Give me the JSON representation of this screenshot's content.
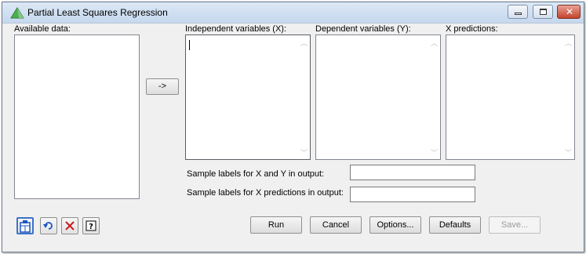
{
  "window": {
    "title": "Partial Least Squares Regression",
    "controls": {
      "minimize": "minimize-icon",
      "maximize": "maximize-icon",
      "close": "close-icon"
    }
  },
  "available_data": {
    "label": "Available data:",
    "items": []
  },
  "move_button": {
    "label": "->"
  },
  "independent": {
    "label": "Independent variables (X):",
    "items": []
  },
  "dependent": {
    "label": "Dependent variables (Y):",
    "items": []
  },
  "x_predictions": {
    "label": "X predictions:",
    "items": []
  },
  "sample_labels_xy": {
    "label": "Sample labels for X and Y in output:",
    "value": ""
  },
  "sample_labels_xpred": {
    "label": "Sample labels for X predictions in output:",
    "value": ""
  },
  "toolbar_icons": [
    "save-to-spreadsheet-icon",
    "undo-icon",
    "clear-icon",
    "help-icon"
  ],
  "buttons": {
    "run": "Run",
    "cancel": "Cancel",
    "options": "Options...",
    "defaults": "Defaults",
    "save": "Save..."
  },
  "colors": {
    "titlebar": "#c5d8ee",
    "close_button": "#c4432c",
    "dialog_background": "#f0f0f0",
    "icon_blue": "#1c55c4",
    "icon_red": "#c81e1e"
  }
}
